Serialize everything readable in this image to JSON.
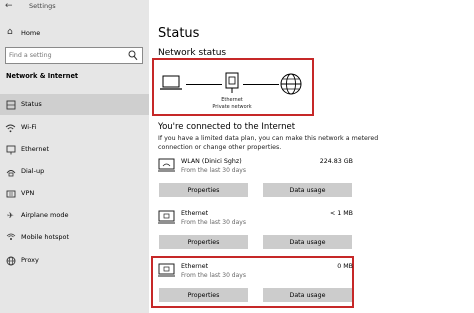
{
  "window": {
    "title": "Settings"
  },
  "sidebar": {
    "home_label": "Home",
    "search_placeholder": "Find a setting",
    "section_title": "Network & Internet",
    "items": [
      {
        "label": "Status",
        "icon": "home-globe-icon",
        "active": true
      },
      {
        "label": "Wi-Fi",
        "icon": "wifi-icon"
      },
      {
        "label": "Ethernet",
        "icon": "ethernet-icon"
      },
      {
        "label": "Dial-up",
        "icon": "dialup-icon"
      },
      {
        "label": "VPN",
        "icon": "vpn-icon"
      },
      {
        "label": "Airplane mode",
        "icon": "airplane-icon"
      },
      {
        "label": "Mobile hotspot",
        "icon": "hotspot-icon"
      },
      {
        "label": "Proxy",
        "icon": "globe-icon"
      }
    ]
  },
  "main": {
    "title": "Status",
    "network_status_heading": "Network status",
    "diagram": {
      "adapter_label": "Ethernet",
      "network_label": "Private network"
    },
    "connected_heading": "You're connected to the Internet",
    "connected_description": "If you have a limited data plan, you can make this network a metered connection or change other properties.",
    "adapters": [
      {
        "name": "WLAN (Dinici Sghz)",
        "since": "From the last 30 days",
        "usage": "224.83 GB",
        "properties_label": "Properties",
        "data_usage_label": "Data usage",
        "icon": "wifi-adapter-icon"
      },
      {
        "name": "Ethernet",
        "since": "From the last 30 days",
        "usage": "< 1 MB",
        "properties_label": "Properties",
        "data_usage_label": "Data usage",
        "icon": "ethernet-adapter-icon"
      },
      {
        "name": "Ethernet",
        "since": "From the last 30 days",
        "usage": "0 MB",
        "properties_label": "Properties",
        "data_usage_label": "Data usage",
        "icon": "ethernet-adapter-icon"
      }
    ]
  },
  "colors": {
    "highlight_border": "#c62828",
    "sidebar_bg": "#e6e6e6",
    "active_item_bg": "#cfcfcf",
    "button_bg": "#cccccc"
  }
}
